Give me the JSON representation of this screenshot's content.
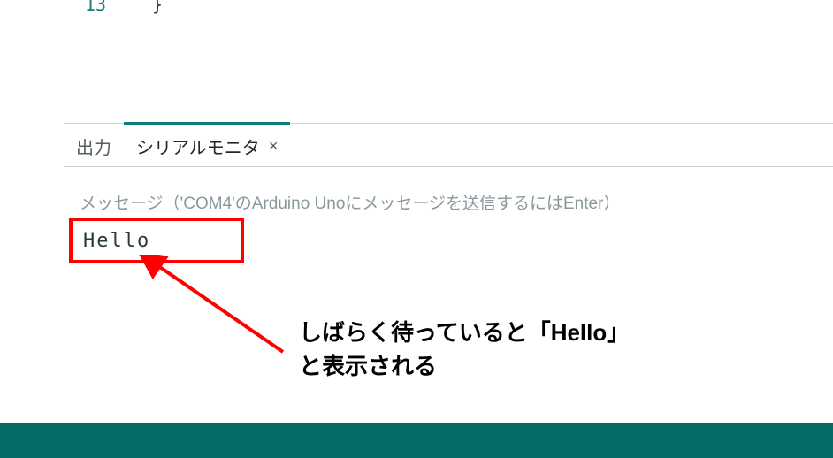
{
  "editor": {
    "line_number": "13",
    "code_line": "}"
  },
  "panel": {
    "tabs": {
      "output": {
        "label": "出力"
      },
      "serial": {
        "label": "シリアルモニタ",
        "close_glyph": "×"
      }
    },
    "serial_monitor": {
      "send_hint": "メッセージ（'COM4'のArduino Unoにメッセージを送信するにはEnter）",
      "output_line": "Hello"
    }
  },
  "annotation": {
    "text": "しばらく待っていると「Hello」\nと表示される"
  }
}
